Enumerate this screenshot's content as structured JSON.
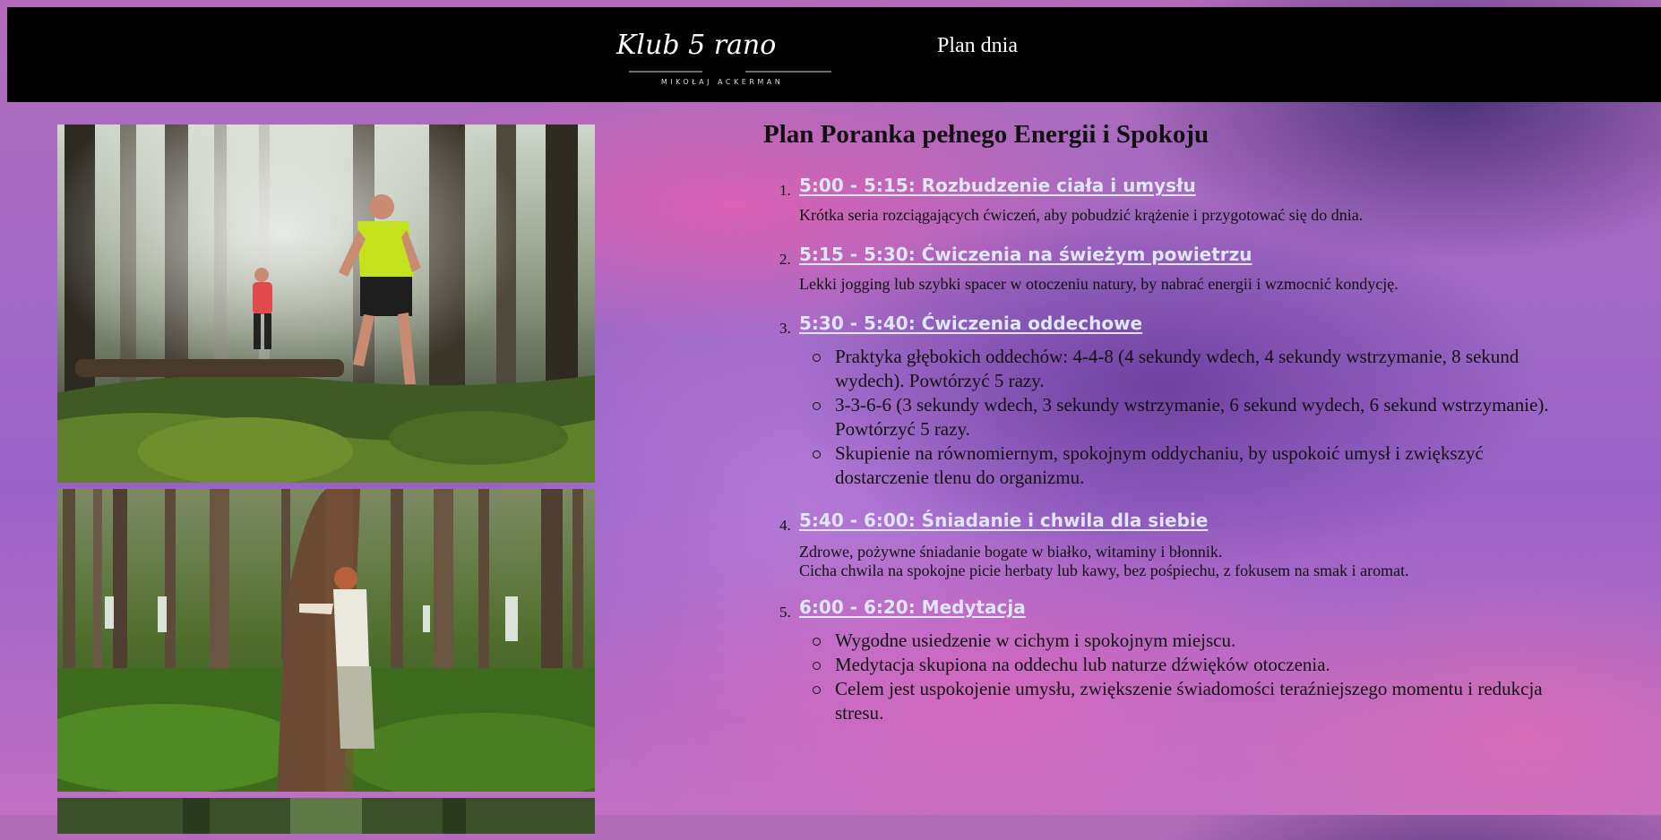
{
  "header": {
    "logo": {
      "text": "Klub 5 rano",
      "subtitle": "MIKOŁAJ ACKERMAN"
    },
    "nav_link": "Plan dnia"
  },
  "gallery": {
    "photos": [
      {
        "name": "forest-running-photo"
      },
      {
        "name": "tree-hugging-photo"
      },
      {
        "name": "third-photo"
      }
    ]
  },
  "plan": {
    "title": "Plan Poranka pełnego Energii i Spokoju",
    "steps": [
      {
        "number": "1.",
        "title": "5:00 - 5:15: Rozbudzenie ciała i umysłu",
        "paragraphs": [
          "Krótka seria rozciągających ćwiczeń, aby pobudzić krążenie i przygotować się do dnia."
        ]
      },
      {
        "number": "2.",
        "title": "5:15 - 5:30: Ćwiczenia na świeżym powietrzu",
        "paragraphs": [
          "Lekki jogging lub szybki spacer w otoczeniu natury, by nabrać energii i wzmocnić kondycję."
        ]
      },
      {
        "number": "3.",
        "title": "5:30 - 5:40: Ćwiczenia oddechowe",
        "bullets": [
          "Praktyka głębokich oddechów: 4-4-8 (4 sekundy wdech, 4 sekundy wstrzymanie, 8 sekund wydech). Powtórzyć 5 razy.",
          "3-3-6-6 (3 sekundy wdech, 3 sekundy wstrzymanie, 6 sekund wydech, 6 sekund wstrzymanie). Powtórzyć 5 razy.",
          "Skupienie na równomiernym, spokojnym oddychaniu, by uspokoić umysł i zwiększyć dostarczenie tlenu do organizmu."
        ]
      },
      {
        "number": "4.",
        "title": "5:40 - 6:00: Śniadanie i chwila dla siebie",
        "paragraphs": [
          "Zdrowe, pożywne śniadanie bogate w białko, witaminy i błonnik.",
          "Cicha chwila na spokojne picie herbaty lub kawy, bez pośpiechu, z fokusem na smak i aromat."
        ]
      },
      {
        "number": "5.",
        "title": "6:00 - 6:20: Medytacja",
        "bullets": [
          "Wygodne usiedzenie w cichym i spokojnym miejscu.",
          "Medytacja skupiona na oddechu lub naturze dźwięków otoczenia.",
          "Celem jest uspokojenie umysłu, zwiększenie świadomości teraźniejszego momentu i redukcja stresu."
        ]
      }
    ]
  }
}
